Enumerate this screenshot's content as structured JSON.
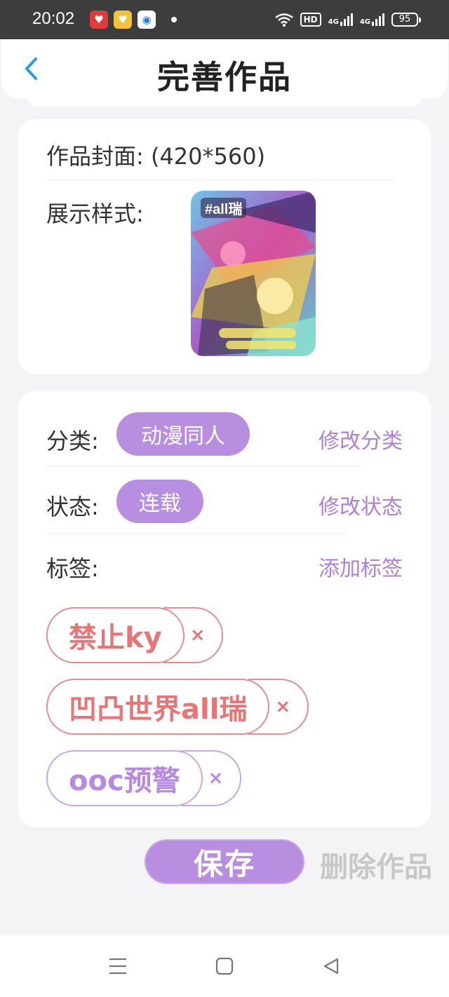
{
  "status_bar": {
    "time": "20:02",
    "apps": [
      "pinduoduo-app-icon",
      "coupon-app-icon",
      "camera-app-icon"
    ],
    "hd_label": "HD",
    "network1": "4G",
    "network2": "4G",
    "battery": "95"
  },
  "header": {
    "title": "完善作品",
    "back_icon": "chevron-left-icon"
  },
  "cover_section": {
    "cover_label": "作品封面: (420*560)",
    "style_label": "展示样式:",
    "cover_image_text": "#all瑞"
  },
  "info_section": {
    "category_label": "分类:",
    "category_value": "动漫同人",
    "category_action": "修改分类",
    "status_label": "状态:",
    "status_value": "连载",
    "status_action": "修改状态",
    "tags_label": "标签:",
    "tags_action": "添加标签",
    "tags": [
      {
        "text": "禁止ky",
        "remove": "×",
        "color": "#e77575"
      },
      {
        "text": "凹凸世界all瑞",
        "remove": "×",
        "color": "#e77575"
      },
      {
        "text": "ooc预警",
        "remove": "×",
        "color": "#b988e3"
      }
    ]
  },
  "buttons": {
    "save": "保存",
    "delete": "删除作品"
  },
  "colors": {
    "accent": "#b88ee0",
    "accent_text": "#b07fd8",
    "tag_red": "#e77575",
    "tag_purple": "#b988e3"
  }
}
